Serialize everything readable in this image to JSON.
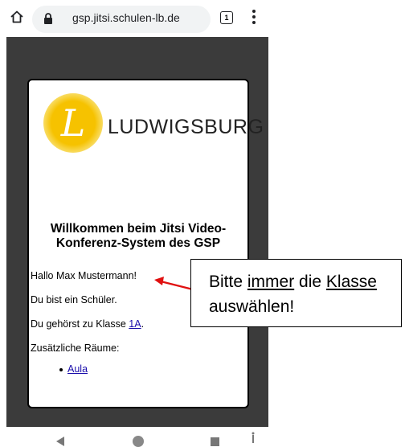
{
  "browser": {
    "url": "gsp.jitsi.schulen-lb.de",
    "tab_count": "1"
  },
  "page": {
    "logo_text": "LUDWIGSBURG",
    "welcome": "Willkommen beim Jitsi Video-Konferenz-System des GSP",
    "greeting": "Hallo Max Mustermann!",
    "role": "Du bist ein Schüler.",
    "class_prefix": "Du gehörst zu Klasse ",
    "class_link": "1A",
    "class_suffix": ".",
    "rooms_label": "Zusätzliche Räume:",
    "rooms": [
      "Aula"
    ]
  },
  "callout": {
    "part1": "Bitte ",
    "part2": "immer",
    "part3": " die ",
    "part4": "Klasse",
    "part5": "auswählen!"
  },
  "colors": {
    "page_bg": "#3b3b3b",
    "logo_yellow": "#f6c200",
    "link": "#1a0dab",
    "arrow": "#e01010"
  }
}
